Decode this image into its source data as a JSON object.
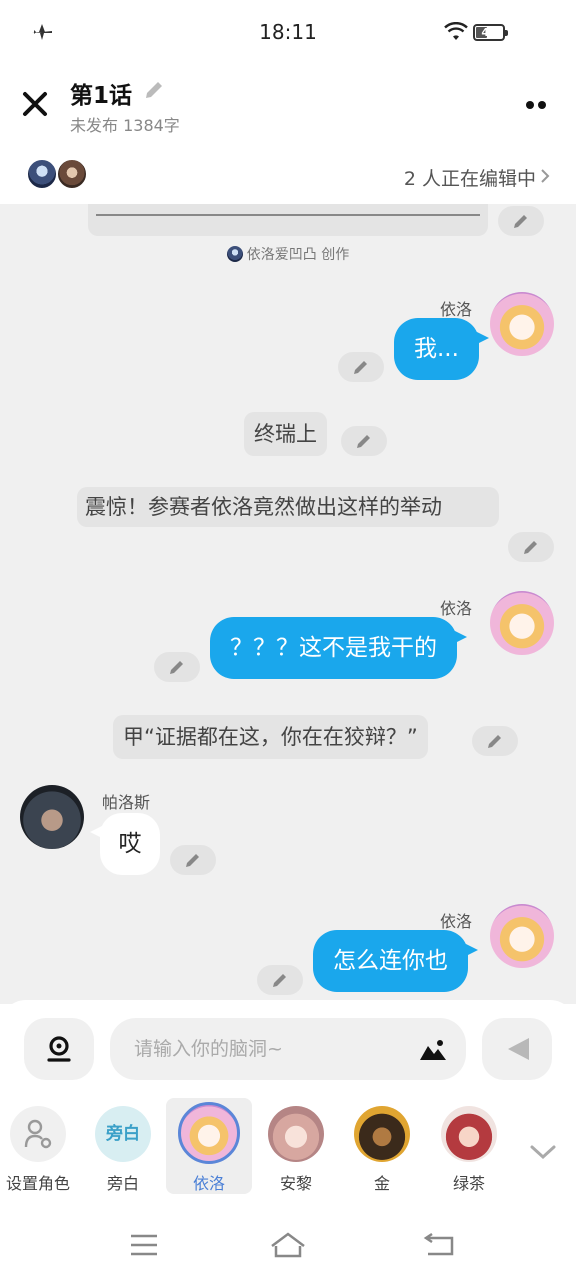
{
  "status": {
    "time": "18:11",
    "battery": "41"
  },
  "header": {
    "title": "第1话",
    "subtitle": "未发布 1384字"
  },
  "collab": {
    "label": "2 人正在编辑中"
  },
  "messages": {
    "credit": "依洛爱凹凸 创作",
    "m1_speaker": "依洛",
    "m1_text": "我...",
    "m2_text": "终瑞上",
    "m3_text": "震惊！参赛者依洛竟然做出这样的举动",
    "m4_speaker": "依洛",
    "m4_text": "？？？这不是我干的",
    "m5_text": "甲“证据都在这，你在在狡辩？”",
    "m6_speaker": "帕洛斯",
    "m6_text": "哎",
    "m7_speaker": "依洛",
    "m7_text": "怎么连你也"
  },
  "input": {
    "placeholder": "请输入你的脑洞~"
  },
  "roles": [
    {
      "name": "设置角色",
      "badge": ""
    },
    {
      "name": "旁白",
      "badge": "旁白"
    },
    {
      "name": "依洛",
      "badge": ""
    },
    {
      "name": "安黎",
      "badge": ""
    },
    {
      "name": "金",
      "badge": ""
    },
    {
      "name": "绿茶",
      "badge": ""
    }
  ],
  "colors": {
    "accent_blue": "#1aa7ec",
    "selected_role": "#4a7fd6"
  }
}
